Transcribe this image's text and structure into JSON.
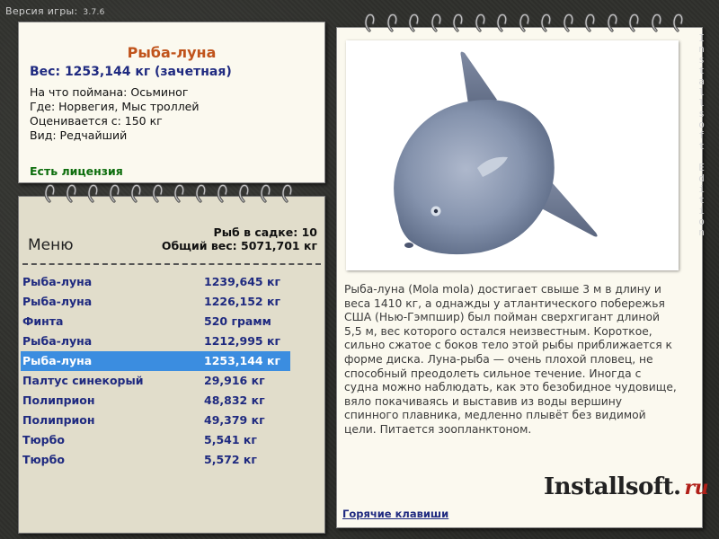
{
  "version": {
    "label": "Версия игры:",
    "number": "3.7.6"
  },
  "fish_card": {
    "title": "Рыба-луна",
    "weight": "Вес: 1253,144 кг (зачетная)",
    "bait": "На что поймана: Осьминог",
    "place": "Где: Норвегия, Мыс троллей",
    "value": "Оценивается с: 150 кг",
    "rarity": "Вид: Редчайший",
    "license": "Есть лицензия"
  },
  "keepnet": {
    "menu_label": "Меню",
    "count": "Рыб в садке: 10",
    "total": "Общий вес: 5071,701 кг",
    "fish": [
      {
        "name": "Рыба-луна",
        "weight": "1239,645 кг"
      },
      {
        "name": "Рыба-луна",
        "weight": "1226,152 кг"
      },
      {
        "name": "Финта",
        "weight": "520 грамм"
      },
      {
        "name": "Рыба-луна",
        "weight": "1212,995 кг"
      },
      {
        "name": "Рыба-луна",
        "weight": "1253,144 кг"
      },
      {
        "name": "Палтус синекорый",
        "weight": "29,916 кг"
      },
      {
        "name": "Полиприон",
        "weight": "48,832 кг"
      },
      {
        "name": "Полиприон",
        "weight": "49,379 кг"
      },
      {
        "name": "Тюрбо",
        "weight": "5,541 кг"
      },
      {
        "name": "Тюрбо",
        "weight": "5,572 кг"
      }
    ],
    "selected_index": 4
  },
  "description": "Рыба-луна (Mola mola) достигает свыше 3 м в длину и веса 1410 кг, а однажды у атлантического побережья США (Нью-Гэмпшир) был пойман сверхгигант длиной 5,5 м, вес которого остался неизвестным. Короткое, сильно сжатое с боков тело этой рыбы приближается к форме диска. Луна-рыба — очень плохой пловец, не способный преодолеть сильное течение. Иногда с судна можно наблюдать, как это безобидное чудовище, вяло покачиваясь и выставив из воды вершину спинного плавника, медленно плывёт без видимой цели. Питается зоопланктоном.",
  "hotkeys_link": "Горячие клавиши",
  "logo": {
    "main": "Installsoft.",
    "suffix": "ru"
  },
  "side_watermark": "Installsoft Edition",
  "colors": {
    "title_orange": "#c0531b",
    "label_blue": "#1f2a80",
    "license_green": "#0c6d0c",
    "selection_blue": "#3b8de0",
    "logo_red": "#b01f18"
  }
}
